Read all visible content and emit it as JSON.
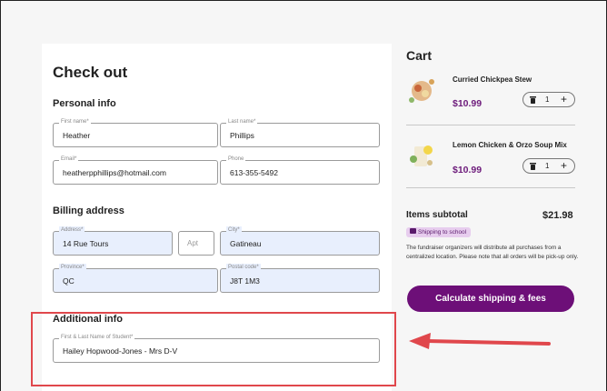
{
  "checkout": {
    "title": "Check out",
    "personal_heading": "Personal info",
    "first_name": {
      "label": "First name*",
      "value": "Heather"
    },
    "last_name": {
      "label": "Last name*",
      "value": "Phillips"
    },
    "email": {
      "label": "Email*",
      "value": "heatherpphillips@hotmail.com"
    },
    "phone": {
      "label": "Phone",
      "value": "613-355-5492"
    },
    "billing_heading": "Billing address",
    "address": {
      "label": "Address*",
      "value": "14 Rue Tours"
    },
    "apt": {
      "placeholder": "Apt"
    },
    "city": {
      "label": "City*",
      "value": "Gatineau"
    },
    "province": {
      "label": "Province*",
      "value": "QC"
    },
    "postal": {
      "label": "Postal code*",
      "value": "J8T 1M3"
    },
    "additional_heading": "Additional info",
    "student": {
      "label": "First & Last Name of Student*",
      "value": "Hailey Hopwood-Jones - Mrs D-V"
    }
  },
  "cart": {
    "title": "Cart",
    "items": [
      {
        "name": "Curried Chickpea Stew",
        "price": "$10.99",
        "qty": "1",
        "icon": "food-thumbnail"
      },
      {
        "name": "Lemon Chicken & Orzo Soup Mix",
        "price": "$10.99",
        "qty": "1",
        "icon": "food-thumbnail"
      }
    ],
    "subtotal_label": "Items subtotal",
    "subtotal_value": "$21.98",
    "shipping_badge": "Shipping to school",
    "note": "The fundraiser organizers will distribute all purchases from a centralized location. Please note that all orders will be pick-up only.",
    "calc_button": "Calculate shipping & fees"
  },
  "annotation": {
    "box_color": "#e0474c",
    "arrow_color": "#e0474c"
  },
  "colors": {
    "accent": "#6d0f78",
    "price": "#6d1b7b",
    "autofill": "#e8effd"
  }
}
